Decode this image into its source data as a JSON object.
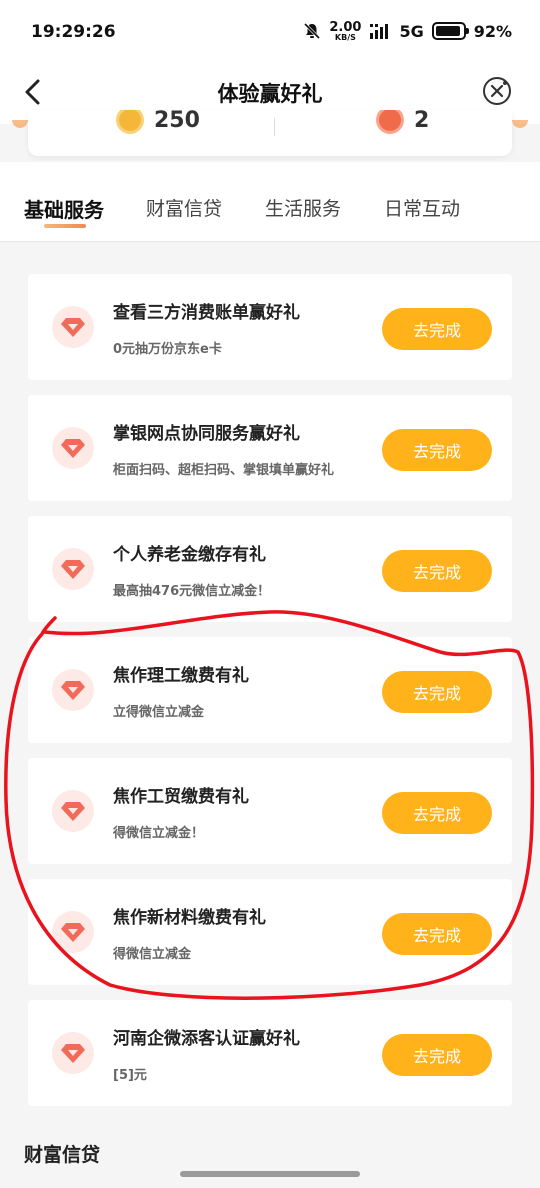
{
  "status": {
    "time": "19:29:26",
    "net_speed_value": "2.00",
    "net_speed_unit": "KB/S",
    "network": "5G",
    "battery_percent": 92
  },
  "nav": {
    "title": "体验赢好礼",
    "back_icon": "chevron-left-icon",
    "close_icon": "close-circle-icon"
  },
  "summary": {
    "coins": "250",
    "gifts": "2"
  },
  "tabs": [
    {
      "label": "基础服务",
      "active": true
    },
    {
      "label": "财富信贷",
      "active": false
    },
    {
      "label": "生活服务",
      "active": false
    },
    {
      "label": "日常互动",
      "active": false
    }
  ],
  "tasks": [
    {
      "title": "查看三方消费账单赢好礼",
      "subtitle": "0元抽万份京东e卡",
      "button": "去完成"
    },
    {
      "title": "掌银网点协同服务赢好礼",
      "subtitle": "柜面扫码、超柜扫码、掌银填单赢好礼",
      "button": "去完成"
    },
    {
      "title": "个人养老金缴存有礼",
      "subtitle": "最高抽476元微信立减金！",
      "button": "去完成"
    },
    {
      "title": "焦作理工缴费有礼",
      "subtitle": "立得微信立减金",
      "button": "去完成"
    },
    {
      "title": "焦作工贸缴费有礼",
      "subtitle": "得微信立减金！",
      "button": "去完成"
    },
    {
      "title": "焦作新材料缴费有礼",
      "subtitle": "得微信立减金",
      "button": "去完成"
    },
    {
      "title": "河南企微添客认证赢好礼",
      "subtitle": "[5]元",
      "button": "去完成"
    }
  ],
  "next_section": {
    "title": "财富信贷"
  },
  "colors": {
    "button": "#ffb21a",
    "icon_bg": "#fde9e6",
    "icon": "#f06b5a",
    "annotation": "#e8131c"
  }
}
